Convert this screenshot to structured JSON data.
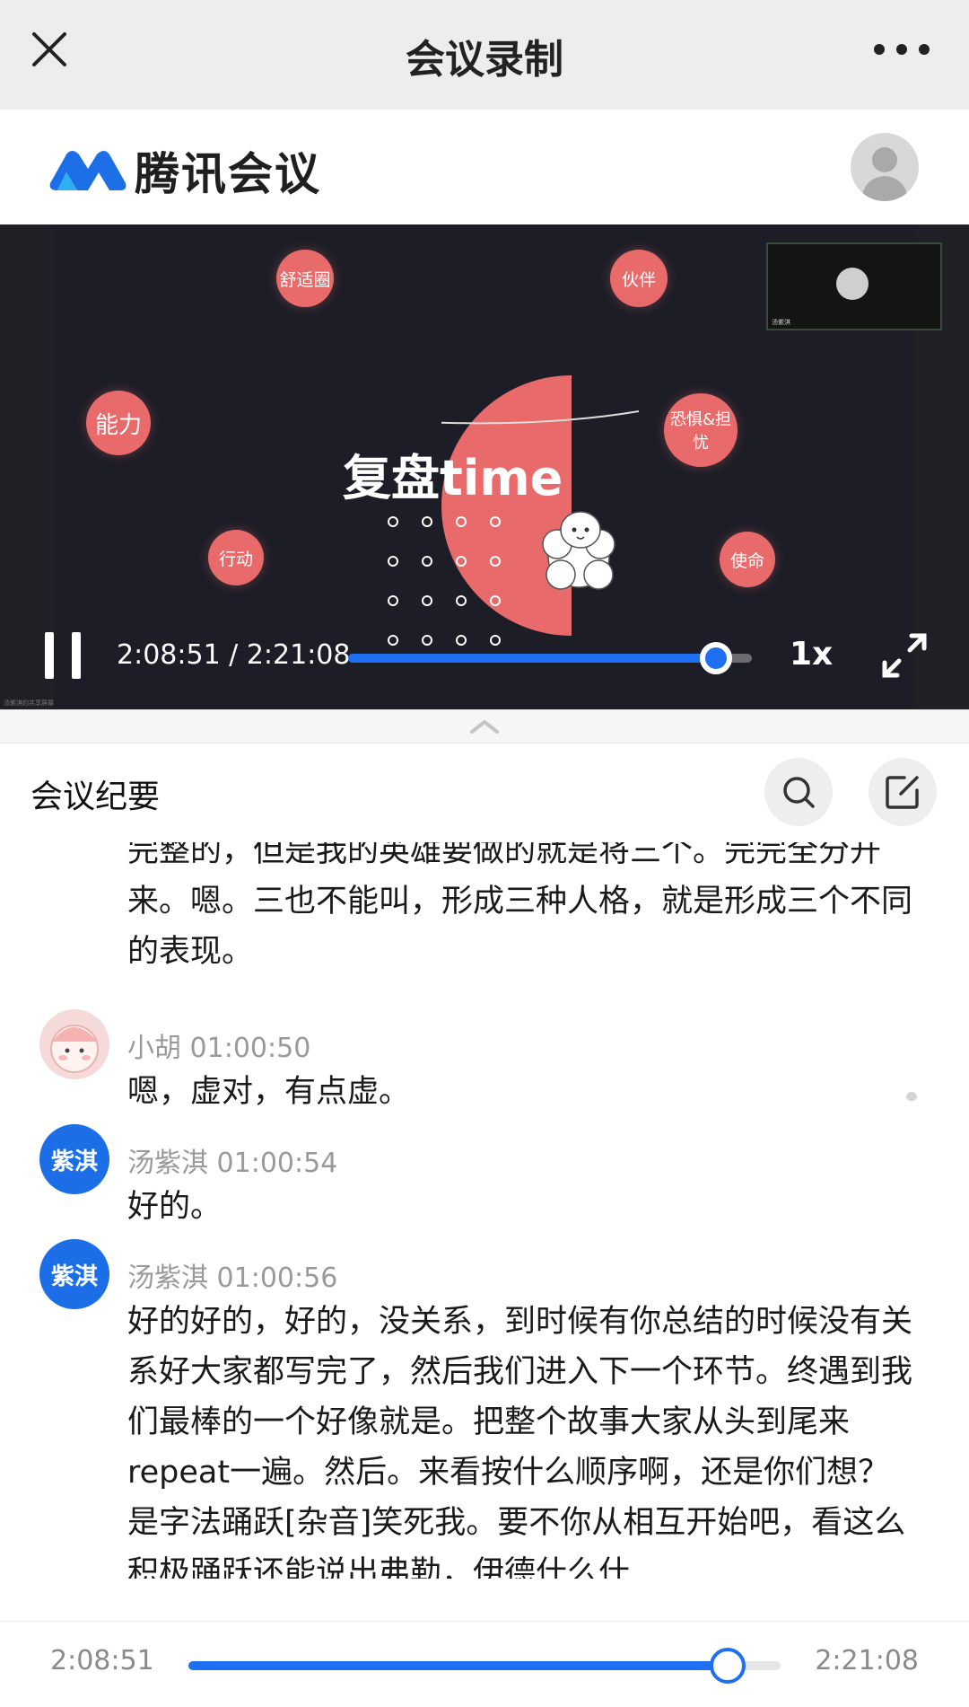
{
  "window": {
    "title": "会议录制"
  },
  "brand": {
    "name": "腾讯会议"
  },
  "video": {
    "slide_title": "复盘time",
    "bubbles": [
      "舒适圈",
      "伙伴",
      "能力",
      "恐惧&担忧",
      "行动",
      "使命"
    ],
    "thumbnail_label": "汤紫淇",
    "watermark": "汤紫淇的共享屏幕",
    "time_display": "2:08:51 / 2:21:08",
    "progress": 0.91,
    "speed": "1x"
  },
  "minutes": {
    "label": "会议纪要",
    "entries": [
      {
        "speaker": "",
        "time": "",
        "text": "完整的，但是我的英雄要做的就是将三个。完完全分开来。嗯。三也不能叫，形成三种人格，就是形成三个不同的表现。"
      },
      {
        "speaker": "小胡",
        "time": "01:00:50",
        "text": "嗯，虚对，有点虚。"
      },
      {
        "speaker": "汤紫淇",
        "avatar_text": "紫淇",
        "time": "01:00:54",
        "text": "好的。"
      },
      {
        "speaker": "汤紫淇",
        "avatar_text": "紫淇",
        "time": "01:00:56",
        "text": "好的好的，好的，没关系，到时候有你总结的时候没有关系好大家都写完了，然后我们进入下一个环节。终遇到我们最棒的一个好像就是。把整个故事大家从头到尾来repeat一遍。然后。来看按什么顺序啊，还是你们想？是字法踊跃[杂音]笑死我。要不你从相互开始吧，看这么积极踊跃还能说出弗勒，伊德什么什"
      }
    ]
  },
  "playback": {
    "current": "2:08:51",
    "total": "2:21:08",
    "progress": 0.91
  },
  "colors": {
    "accent": "#1f6ff2",
    "bubble": "#e86a6a",
    "video_bg": "#1c1d27"
  }
}
